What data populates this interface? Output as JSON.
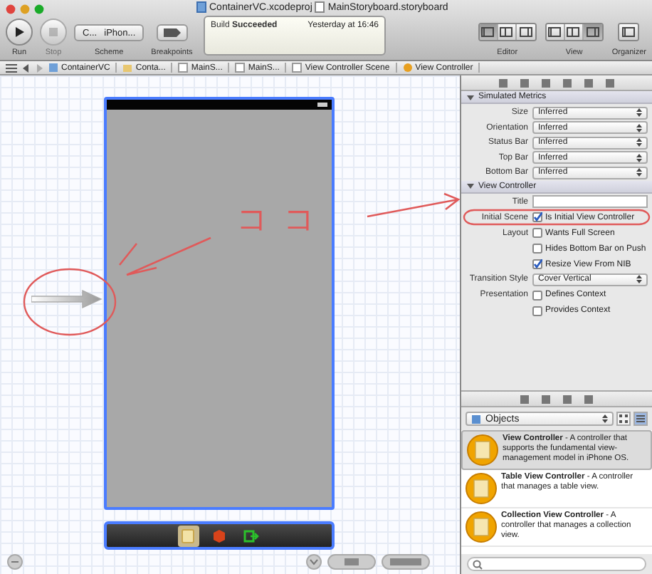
{
  "window": {
    "project": "ContainerVC.xcodeproj",
    "file": "MainStoryboard.storyboard"
  },
  "toolbar": {
    "run": {
      "label": "Run",
      "disabled": false
    },
    "stop": {
      "label": "Stop",
      "disabled": true
    },
    "scheme": {
      "target": "C...",
      "device": "iPhon...",
      "label": "Scheme"
    },
    "breakpoints": {
      "label": "Breakpoints"
    },
    "activity": {
      "status": "Build **Succeeded**",
      "time": "Yesterday at 16:46"
    },
    "groups": [
      {
        "label": "Editor",
        "segments": [
          {
            "selected": true
          },
          {
            "selected": false
          },
          {
            "selected": false
          }
        ]
      },
      {
        "label": "View",
        "segments": [
          {
            "selected": false
          },
          {
            "selected": false
          },
          {
            "selected": true
          }
        ]
      },
      {
        "label": "Organizer",
        "segments": [
          {
            "selected": false
          }
        ]
      }
    ]
  },
  "jump_bar": [
    "ContainerVC",
    "Conta...",
    "MainS...",
    "MainS...",
    "View Controller Scene",
    "View Controller"
  ],
  "canvas": {
    "scene": {
      "selected": true
    },
    "dock": [
      {
        "kind": "controller",
        "selected": true
      },
      {
        "kind": "cube",
        "selected": false
      },
      {
        "kind": "exit",
        "selected": false
      }
    ]
  },
  "annotation": {
    "text": "ココ"
  },
  "inspector": {
    "sections": [
      {
        "title": "Simulated Metrics",
        "expanded": true,
        "rows": [
          {
            "kind": "popup",
            "label": "Size",
            "value": "Inferred"
          },
          {
            "kind": "popup",
            "label": "Orientation",
            "value": "Inferred"
          },
          {
            "kind": "popup",
            "label": "Status Bar",
            "value": "Inferred"
          },
          {
            "kind": "popup",
            "label": "Top Bar",
            "value": "Inferred"
          },
          {
            "kind": "popup",
            "label": "Bottom Bar",
            "value": "Inferred"
          }
        ]
      },
      {
        "title": "View Controller",
        "expanded": true,
        "rows": [
          {
            "kind": "field",
            "label": "Title"
          },
          {
            "kind": "checkbox",
            "label": "Initial Scene",
            "text": "Is Initial View Controller",
            "checked": true
          },
          {
            "kind": "checkbox",
            "label": "Layout",
            "text": "Wants Full Screen",
            "checked": false
          },
          {
            "kind": "checkbox",
            "text": "Hides Bottom Bar on Push",
            "checked": false
          },
          {
            "kind": "checkbox",
            "text": "Resize View From NIB",
            "checked": true
          },
          {
            "kind": "popup",
            "label": "Transition Style",
            "value": "Cover Vertical"
          },
          {
            "kind": "checkbox",
            "label": "Presentation",
            "text": "Defines Context",
            "checked": false
          },
          {
            "kind": "checkbox",
            "text": "Provides Context",
            "checked": false
          }
        ]
      }
    ]
  },
  "library": {
    "filter": "Objects",
    "modes": [
      {
        "selected": false
      },
      {
        "selected": true
      }
    ],
    "items": [
      {
        "text": "**View Controller** - A controller that supports the fundamental view-management model in iPhone OS.",
        "selected": true
      },
      {
        "text": "**Table View Controller** - A controller that manages a table view.",
        "selected": false
      },
      {
        "text": "**Collection View Controller** - A controller that manages a collection view.",
        "selected": false
      }
    ]
  }
}
